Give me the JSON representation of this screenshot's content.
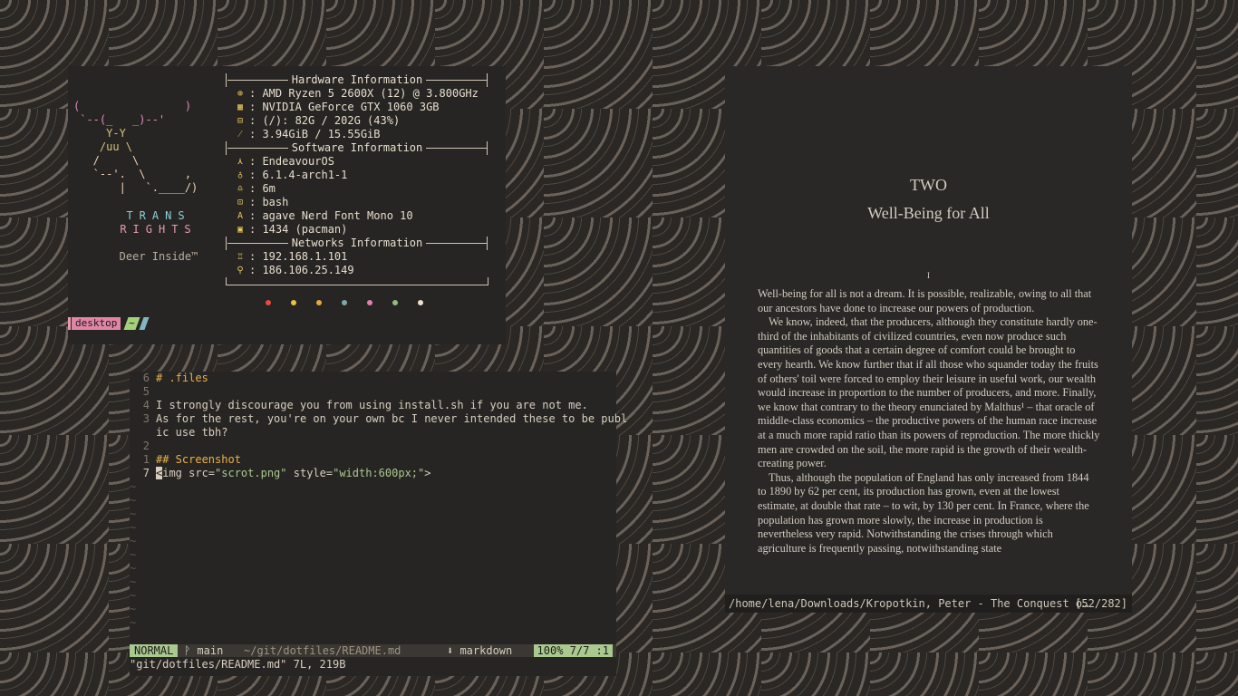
{
  "fetch": {
    "ascii_lines": [
      "(                )",
      " `--(_   _)--'",
      "     Y-Y",
      "    /uu \\",
      "   /     \\",
      "   `--'.  \\      ,",
      "       |   `.____/)"
    ],
    "trans_line1": "TRANS",
    "trans_line2": "RIGHTS",
    "tagline": "Deer Inside™",
    "sections": [
      {
        "title": "Hardware Information",
        "rows": [
          {
            "icon": "cpu-icon",
            "glyph": "⊕",
            "text": "AMD Ryzen 5 2600X (12) @ 3.800GHz"
          },
          {
            "icon": "gpu-icon",
            "glyph": "▦",
            "text": "NVIDIA GeForce GTX 1060 3GB"
          },
          {
            "icon": "disk-icon",
            "glyph": "⊟",
            "text": "(/): 82G / 202G (43%)"
          },
          {
            "icon": "memory-icon",
            "glyph": "⁄",
            "text": "3.94GiB / 15.55GiB"
          }
        ]
      },
      {
        "title": "Software Information",
        "rows": [
          {
            "icon": "distro-icon",
            "glyph": "⋏",
            "text": "EndeavourOS"
          },
          {
            "icon": "kernel-icon",
            "glyph": "♁",
            "text": "6.1.4-arch1-1"
          },
          {
            "icon": "uptime-icon",
            "glyph": "♎",
            "text": "6m"
          },
          {
            "icon": "shell-icon",
            "glyph": "⊡",
            "text": "bash"
          },
          {
            "icon": "font-icon",
            "glyph": "A",
            "text": "agave Nerd Font Mono 10"
          },
          {
            "icon": "packages-icon",
            "glyph": "▣",
            "text": "1434 (pacman)"
          }
        ]
      },
      {
        "title": "Networks Information",
        "rows": [
          {
            "icon": "local-ip-icon",
            "glyph": "♖",
            "text": "192.168.1.101"
          },
          {
            "icon": "public-ip-icon",
            "glyph": "⚲",
            "text": "186.106.25.149"
          }
        ]
      }
    ],
    "palette": [
      "#e84b3c",
      "#e8c240",
      "#e8a83c",
      "#7fa8a8",
      "#e07fb0",
      "#8fbf7a",
      "#f0e0c8"
    ],
    "prompt": {
      "workspace": "desktop",
      "dir": "~"
    }
  },
  "nvim": {
    "lines": [
      {
        "num": "6",
        "text": "# .files",
        "kind": "heading"
      },
      {
        "num": "5",
        "text": "",
        "kind": "text"
      },
      {
        "num": "4",
        "text": "I strongly discourage you from using install.sh if you are not me.",
        "kind": "text"
      },
      {
        "num": "3",
        "text": "As for the rest, you're on your own bc I never intended these to be publ",
        "kind": "text"
      },
      {
        "num": "",
        "text": "ic use tbh?",
        "kind": "text"
      },
      {
        "num": "2",
        "text": "",
        "kind": "text"
      },
      {
        "num": "1",
        "text": "## Screenshot",
        "kind": "heading"
      },
      {
        "num": "7",
        "text": "<img src=\"scrot.png\" style=\"width:600px;\">",
        "kind": "current"
      }
    ],
    "statusline": {
      "mode": "NORMAL",
      "branch": "ᚹ main",
      "path": "~/git/dotfiles/README.md",
      "filetype": "⬇ markdown",
      "position": "100% 7/7 :1"
    },
    "cmdline": "\"git/dotfiles/README.md\" 7L, 219B"
  },
  "reader": {
    "chapter_number": "TWO",
    "chapter_title": "Well-Being for All",
    "section_mark": "I",
    "paragraphs": [
      "Well-being for all is not a dream. It is possible, realizable, owing to all that our ancestors have done to increase our powers of production.",
      "We know, indeed, that the producers, although they constitute hardly one-third of the inhabitants of civilized countries, even now produce such quantities of goods that a certain degree of comfort could be brought to every hearth. We know further that if all those who squander today the fruits of others' toil were forced to employ their leisure in useful work, our wealth would increase in proportion to the number of producers, and more. Finally, we know that contrary to the theory enunciated by Malthus¹ – that oracle of middle-class economics – the productive powers of the human race increase at a much more rapid ratio than its powers of reproduction. The more thickly men are crowded on the soil, the more rapid is the growth of their wealth-creating power.",
      "Thus, although the population of England has only increased from 1844 to 1890 by 62 per cent, its production has grown, even at the lowest estimate, at double that rate – to wit, by 130 per cent. In France, where the population has grown more slowly, the increase in production is nevertheless very rapid. Notwithstanding the crises through which agriculture is frequently passing, notwithstanding state"
    ],
    "status_path": "/home/lena/Downloads/Kropotkin, Peter - The Conquest o…",
    "status_page": "[52/282]"
  }
}
